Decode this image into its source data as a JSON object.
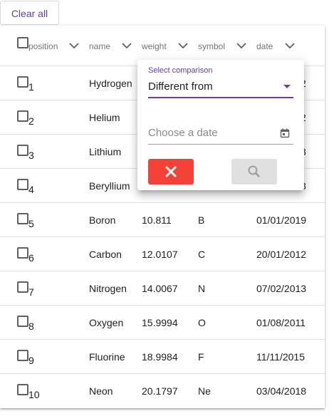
{
  "toolbar": {
    "clear_all_label": "Clear all"
  },
  "table": {
    "columns": [
      {
        "key": "position",
        "label": "position"
      },
      {
        "key": "name",
        "label": "name"
      },
      {
        "key": "weight",
        "label": "weight"
      },
      {
        "key": "symbol",
        "label": "symbol"
      },
      {
        "key": "date",
        "label": "date"
      }
    ],
    "rows": [
      {
        "position": "1",
        "name": "Hydrogen",
        "weight": "",
        "symbol": "",
        "date": "2"
      },
      {
        "position": "2",
        "name": "Helium",
        "weight": "",
        "symbol": "",
        "date": "2"
      },
      {
        "position": "3",
        "name": "Lithium",
        "weight": "",
        "symbol": "",
        "date": "3"
      },
      {
        "position": "4",
        "name": "Beryllium",
        "weight": "",
        "symbol": "",
        "date": "3"
      },
      {
        "position": "5",
        "name": "Boron",
        "weight": "10.811",
        "symbol": "B",
        "date": "01/01/2019"
      },
      {
        "position": "6",
        "name": "Carbon",
        "weight": "12.0107",
        "symbol": "C",
        "date": "20/01/2012"
      },
      {
        "position": "7",
        "name": "Nitrogen",
        "weight": "14.0067",
        "symbol": "N",
        "date": "07/02/2013"
      },
      {
        "position": "8",
        "name": "Oxygen",
        "weight": "15.9994",
        "symbol": "O",
        "date": "01/08/2011"
      },
      {
        "position": "9",
        "name": "Fluorine",
        "weight": "18.9984",
        "symbol": "F",
        "date": "11/11/2015"
      },
      {
        "position": "10",
        "name": "Neon",
        "weight": "20.1797",
        "symbol": "Ne",
        "date": "03/04/2018"
      }
    ]
  },
  "filter_popup": {
    "comparison_label": "Select comparison",
    "comparison_value": "Different from",
    "date_placeholder": "Choose a date",
    "date_value": ""
  },
  "colors": {
    "accent": "#673ab7",
    "cancel": "#f44336",
    "disabled": "#e0e0e0"
  },
  "icons": {
    "sort": "chevron-down-icon",
    "calendar": "calendar-icon",
    "cancel": "close-icon",
    "search": "search-icon",
    "select_arrow": "caret-down-icon"
  }
}
